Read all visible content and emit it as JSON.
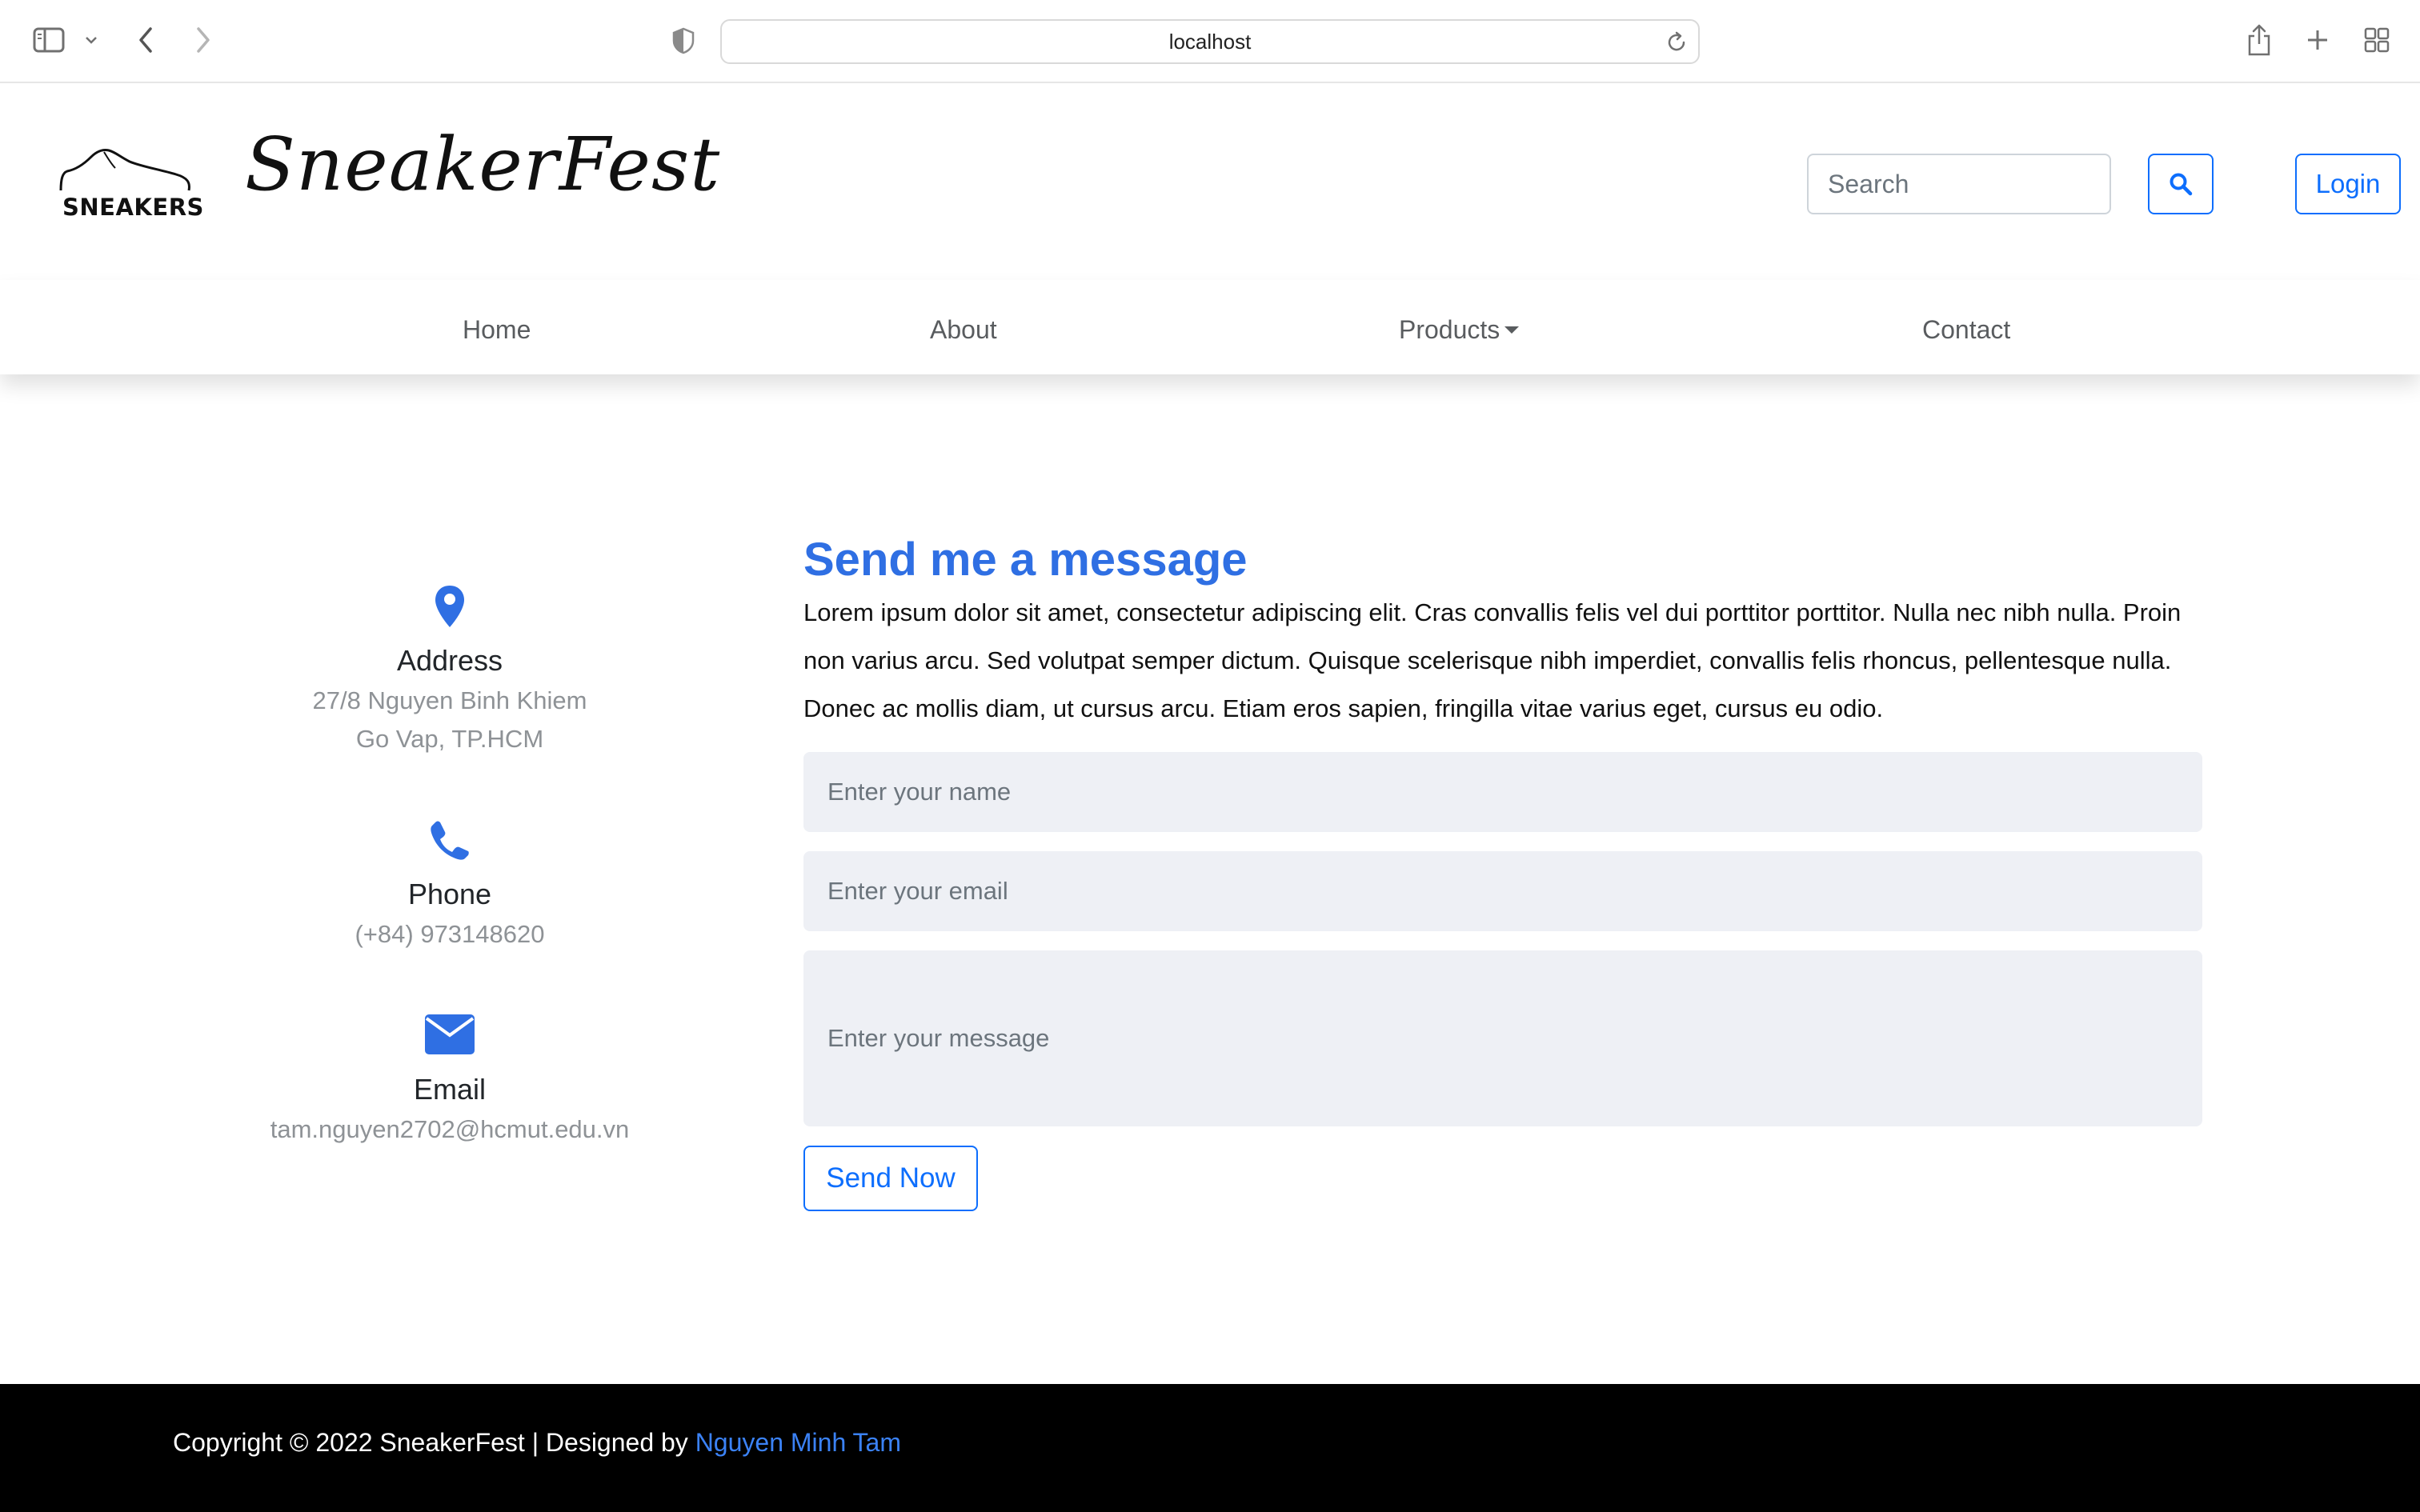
{
  "browser": {
    "url": "localhost"
  },
  "header": {
    "logo_text": "SNEAKERS",
    "brand": "SneakerFest",
    "search_placeholder": "Search",
    "login_label": "Login"
  },
  "nav": {
    "items": [
      {
        "label": "Home"
      },
      {
        "label": "About"
      },
      {
        "label": "Products"
      },
      {
        "label": "Contact"
      }
    ]
  },
  "contact_info": {
    "address": {
      "title": "Address",
      "line1": "27/8 Nguyen Binh Khiem",
      "line2": "Go Vap, TP.HCM",
      "icon": "map-pin-icon"
    },
    "phone": {
      "title": "Phone",
      "value": "(+84) 973148620",
      "icon": "phone-icon"
    },
    "email": {
      "title": "Email",
      "value": "tam.nguyen2702@hcmut.edu.vn",
      "icon": "envelope-icon"
    }
  },
  "form": {
    "title": "Send me a message",
    "description": "Lorem ipsum dolor sit amet, consectetur adipiscing elit. Cras convallis felis vel dui porttitor porttitor. Nulla nec nibh nulla. Proin non varius arcu. Sed volutpat semper dictum. Quisque scelerisque nibh imperdiet, convallis felis rhoncus, pellentesque nulla. Donec ac mollis diam, ut cursus arcu. Etiam eros sapien, fringilla vitae varius eget, cursus eu odio.",
    "name_placeholder": "Enter your name",
    "email_placeholder": "Enter your email",
    "message_placeholder": "Enter your message",
    "send_label": "Send Now"
  },
  "footer": {
    "text": "Copyright © 2022 SneakerFest | Designed by ",
    "author": "Nguyen Minh Tam"
  },
  "colors": {
    "accent": "#0d6efd",
    "title_blue": "#2f6fe3",
    "muted_text": "#8e9296",
    "field_bg": "#eef0f5",
    "footer_bg": "#000000"
  }
}
